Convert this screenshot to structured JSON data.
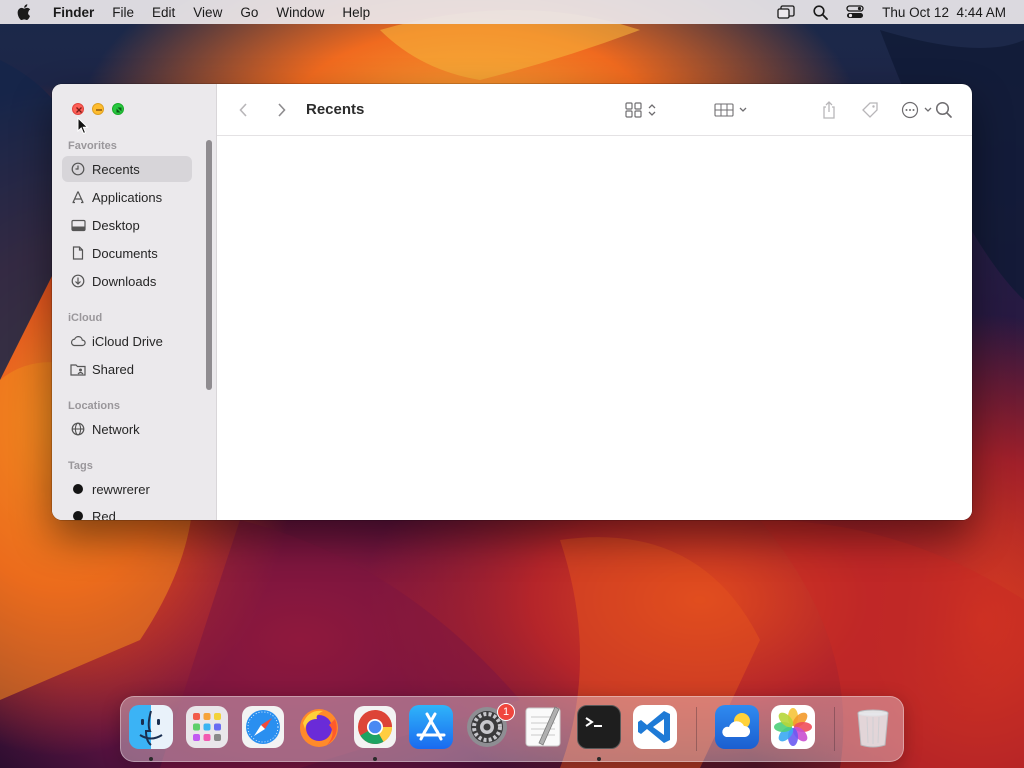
{
  "menubar": {
    "app_name": "Finder",
    "items": [
      "File",
      "Edit",
      "View",
      "Go",
      "Window",
      "Help"
    ],
    "datetime": "Thu Oct 12  4:44 AM"
  },
  "window": {
    "title": "Recents"
  },
  "sidebar": {
    "favorites_title": "Favorites",
    "favorites": [
      {
        "label": "Recents",
        "icon": "clock-icon"
      },
      {
        "label": "Applications",
        "icon": "applications-icon"
      },
      {
        "label": "Desktop",
        "icon": "desktop-icon"
      },
      {
        "label": "Documents",
        "icon": "document-icon"
      },
      {
        "label": "Downloads",
        "icon": "download-icon"
      }
    ],
    "icloud_title": "iCloud",
    "icloud": [
      {
        "label": "iCloud Drive",
        "icon": "cloud-icon"
      },
      {
        "label": "Shared",
        "icon": "shared-folder-icon"
      }
    ],
    "locations_title": "Locations",
    "locations": [
      {
        "label": "Network",
        "icon": "globe-icon"
      }
    ],
    "tags_title": "Tags",
    "tags": [
      {
        "label": "rewwrerer",
        "color": "#141414"
      },
      {
        "label": "Red",
        "color": "#141414"
      }
    ]
  },
  "dock": {
    "apps": [
      {
        "name": "Finder",
        "icon": "finder-icon",
        "running": true
      },
      {
        "name": "Launchpad",
        "icon": "launchpad-icon",
        "running": false
      },
      {
        "name": "Safari",
        "icon": "safari-icon",
        "running": false
      },
      {
        "name": "Firefox",
        "icon": "firefox-icon",
        "running": false
      },
      {
        "name": "Chrome",
        "icon": "chrome-icon",
        "running": true
      },
      {
        "name": "App Store",
        "icon": "app-store-icon",
        "running": false
      },
      {
        "name": "System Settings",
        "icon": "settings-gear-icon",
        "running": false,
        "badge": "1"
      },
      {
        "name": "TextEdit",
        "icon": "textedit-icon",
        "running": false
      },
      {
        "name": "Terminal",
        "icon": "terminal-icon",
        "running": true
      },
      {
        "name": "VS Code",
        "icon": "vscode-icon",
        "running": false
      },
      {
        "name": "Weather",
        "icon": "weather-icon",
        "running": false
      },
      {
        "name": "Photos",
        "icon": "photos-icon",
        "running": false
      },
      {
        "name": "Trash",
        "icon": "trash-icon",
        "running": false
      }
    ]
  },
  "colors": {
    "selection": "#d7d5d9",
    "close": "#fe5f57",
    "minimize": "#febc2e",
    "maximize": "#28c840"
  }
}
